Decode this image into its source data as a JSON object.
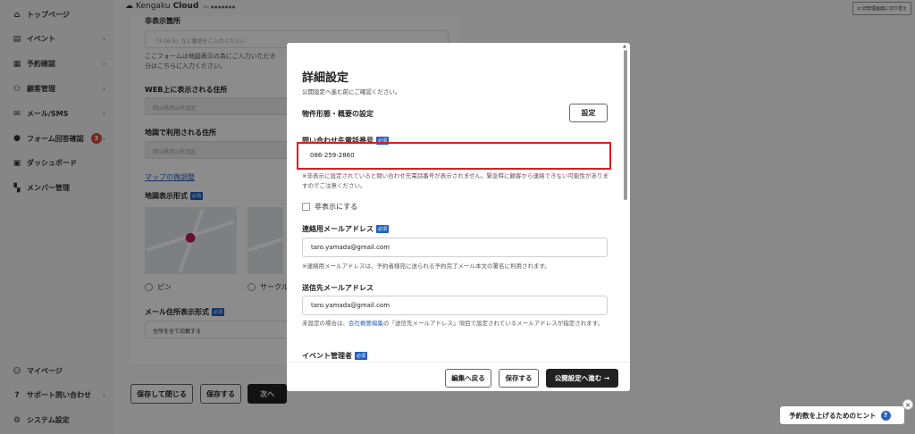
{
  "sidebar": {
    "items": [
      {
        "label": "トップページ",
        "icon": "home-icon"
      },
      {
        "label": "イベント",
        "icon": "document-icon"
      },
      {
        "label": "予約確認",
        "icon": "calendar-icon"
      },
      {
        "label": "顧客管理",
        "icon": "users-icon"
      },
      {
        "label": "メール/SMS",
        "icon": "mail-icon"
      },
      {
        "label": "フォーム回答確認",
        "icon": "chat-icon",
        "badge": "3"
      },
      {
        "label": "ダッシュボード",
        "icon": "chart-icon"
      },
      {
        "label": "メンバー管理",
        "icon": "grid-icon"
      }
    ],
    "bottom_items": [
      {
        "label": "マイページ",
        "icon": "person-icon"
      },
      {
        "label": "サポート問い合わせ",
        "icon": "help-icon"
      },
      {
        "label": "システム設定",
        "icon": "gear-icon"
      }
    ]
  },
  "header": {
    "logo_text": "Kengaku",
    "logo_bold": "Cloud",
    "logo_tagline": "by ●●●●●●●",
    "admin_switch": "旧管理画面に切り替え"
  },
  "background_form": {
    "hidden_section_label": "非表示箇所",
    "hidden_placeholder": "「3-16-5」など番地をご入力ください",
    "hidden_note": "ここフォームは地図表示の為にご入力いただき",
    "hidden_note2": "分はこちらに入力ください。",
    "web_address_label": "WEB上に表示される住所",
    "web_address_value": "岡山県岡山市北区",
    "map_address_label": "地図で利用される住所",
    "map_address_value": "岡山県岡山市北区",
    "map_adjust_link": "マップの微調整",
    "map_display_label": "地図表示形式",
    "radio_pin": "ピン",
    "radio_circle": "サークル",
    "mail_address_format_label": "メール住所表示形式",
    "mail_address_format_value": "住所を全て記載する",
    "required_badge": "必須"
  },
  "bottom_buttons": {
    "save_close": "保存して閉じる",
    "save": "保存する",
    "next": "次へ"
  },
  "modal": {
    "title": "詳細設定",
    "subtitle": "公開設定へ進む前にご確認ください。",
    "property_label": "物件形態・概要の設定",
    "settings_button": "設定",
    "phone_label": "問い合わせ先電話番号",
    "required_badge": "必須",
    "phone_value": "086-259-2860",
    "phone_note": "※非表示に設定されていると問い合わせ先電話番号が表示されません。緊急時に顧客から連絡できない可能性がありますのでご注意ください。",
    "hide_checkbox": "非表示にする",
    "contact_email_label": "連絡用メールアドレス",
    "contact_email_value": "taro.yamada@gmail.com",
    "contact_email_note": "※連絡用メールアドレスは、予約者様宛に送られる予約完了メール本文の署名に利用されます。",
    "send_email_label": "送信先メールアドレス",
    "send_email_value": "taro.yamada@gmail.com",
    "send_note_pre": "未設定の場合は、",
    "send_note_link": "会社概要編集",
    "send_note_post": "の「送信先メールアドレス」項目で設定されているメールアドレスが指定されます。",
    "event_manager_label": "イベント管理者",
    "footer": {
      "back": "編集へ戻る",
      "save": "保存する",
      "publish": "公開設定へ進む →"
    }
  },
  "hint": {
    "text": "予約数を上げるためのヒント",
    "close": "×"
  },
  "colors": {
    "highlight": "#e01b1b",
    "accent": "#2a62b8",
    "required_badge": "#1f5fbf"
  }
}
